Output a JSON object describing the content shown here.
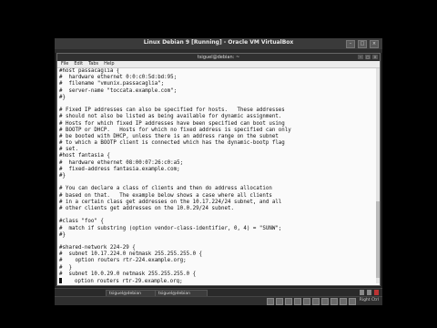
{
  "vbox": {
    "title": "Linux Debian 9 [Running] - Oracle VM VirtualBox",
    "host_key": "Right Ctrl"
  },
  "terminal": {
    "title": "tsiguel@debian: ~",
    "menu": [
      "File",
      "Edit",
      "Tabs",
      "Help"
    ],
    "lines": [
      "#host passacaglia {",
      "#  hardware ethernet 0:0:c0:5d:bd:95;",
      "#  filename \"vmunix.passacaglia\";",
      "#  server-name \"toccata.example.com\";",
      "#}",
      "",
      "# Fixed IP addresses can also be specified for hosts.   These addresses",
      "# should not also be listed as being available for dynamic assignment.",
      "# Hosts for which fixed IP addresses have been specified can boot using",
      "# BOOTP or DHCP.   Hosts for which no fixed address is specified can only",
      "# be booted with DHCP, unless there is an address range on the subnet",
      "# to which a BOOTP client is connected which has the dynamic-bootp flag",
      "# set.",
      "#host fantasia {",
      "#  hardware ethernet 08:00:07:26:c0:a5;",
      "#  fixed-address fantasia.example.com;",
      "#}",
      "",
      "# You can declare a class of clients and then do address allocation",
      "# based on that.   The example below shows a case where all clients",
      "# in a certain class get addresses on the 10.17.224/24 subnet, and all",
      "# other clients get addresses on the 10.0.29/24 subnet.",
      "",
      "#class \"foo\" {",
      "#  match if substring (option vendor-class-identifier, 0, 4) = \"SUNW\";",
      "#}",
      "",
      "#shared-network 224-29 {",
      "#  subnet 10.17.224.0 netmask 255.255.255.0 {",
      "#    option routers rtr-224.example.org;",
      "#  }",
      "#  subnet 10.0.29.0 netmask 255.255.255.0 {",
      "    option routers rtr-29.example.org;"
    ]
  },
  "taskbar": {
    "items": [
      "tsiguel@debian",
      "tsiguel@debian"
    ]
  }
}
